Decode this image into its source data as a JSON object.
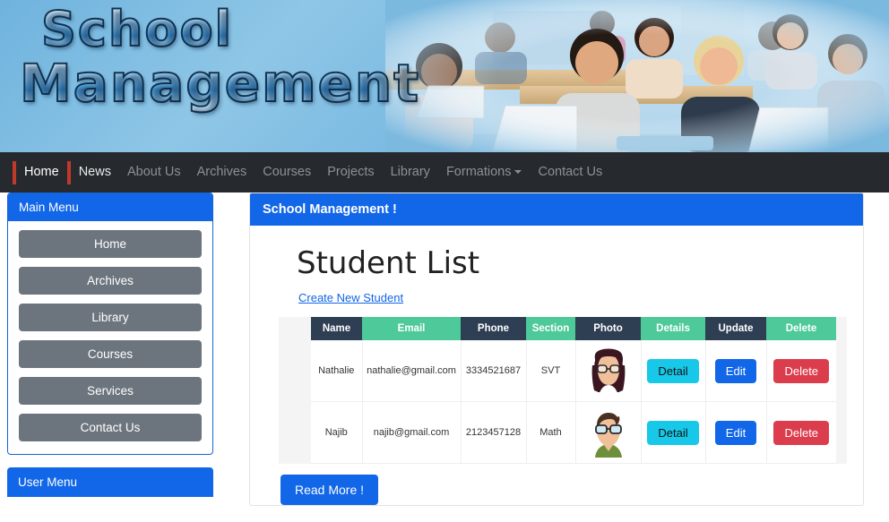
{
  "banner": {
    "logo_line1": "School",
    "logo_line2": "Management",
    "photo_alt": "students-classroom-photo"
  },
  "topnav": {
    "items": [
      {
        "label": "Home",
        "state": "active"
      },
      {
        "label": "News",
        "state": "bright"
      },
      {
        "label": "About Us",
        "state": "normal"
      },
      {
        "label": "Archives",
        "state": "normal"
      },
      {
        "label": "Courses",
        "state": "normal"
      },
      {
        "label": "Projects",
        "state": "normal"
      },
      {
        "label": "Library",
        "state": "normal"
      },
      {
        "label": "Formations",
        "state": "normal",
        "has_caret": true
      },
      {
        "label": "Contact Us",
        "state": "normal"
      }
    ]
  },
  "sidebar": {
    "main_menu": {
      "title": "Main Menu",
      "items": [
        {
          "label": "Home"
        },
        {
          "label": "Archives"
        },
        {
          "label": "Library"
        },
        {
          "label": "Courses"
        },
        {
          "label": "Services"
        },
        {
          "label": "Contact Us"
        }
      ]
    },
    "user_menu": {
      "title": "User Menu"
    }
  },
  "main": {
    "card_title": "School Management !",
    "page_title": "Student List",
    "create_link": "Create New Student",
    "read_more": "Read More !",
    "table": {
      "columns": [
        {
          "label": "Name",
          "style": "dark"
        },
        {
          "label": "Email",
          "style": "teal"
        },
        {
          "label": "Phone",
          "style": "dark"
        },
        {
          "label": "Section",
          "style": "teal"
        },
        {
          "label": "Photo",
          "style": "dark"
        },
        {
          "label": "Details",
          "style": "teal"
        },
        {
          "label": "Update",
          "style": "dark"
        },
        {
          "label": "Delete",
          "style": "teal"
        }
      ],
      "rows": [
        {
          "name": "Nathalie",
          "email": "nathalie@gmail.com",
          "phone": "3334521687",
          "section": "SVT",
          "photo": "female-avatar",
          "detail_label": "Detail",
          "update_label": "Edit",
          "delete_label": "Delete"
        },
        {
          "name": "Najib",
          "email": "najib@gmail.com",
          "phone": "2123457128",
          "section": "Math",
          "photo": "male-avatar",
          "detail_label": "Detail",
          "update_label": "Edit",
          "delete_label": "Delete"
        }
      ]
    }
  },
  "colors": {
    "primary_blue": "#1266e8",
    "nav_bg": "#262a2e",
    "nav_accent_red": "#c0392b",
    "header_dark": "#2e3f54",
    "header_teal": "#4ec99a",
    "btn_detail": "#17c8e8",
    "btn_delete": "#dc3d4d",
    "menu_grey": "#6c757d"
  }
}
